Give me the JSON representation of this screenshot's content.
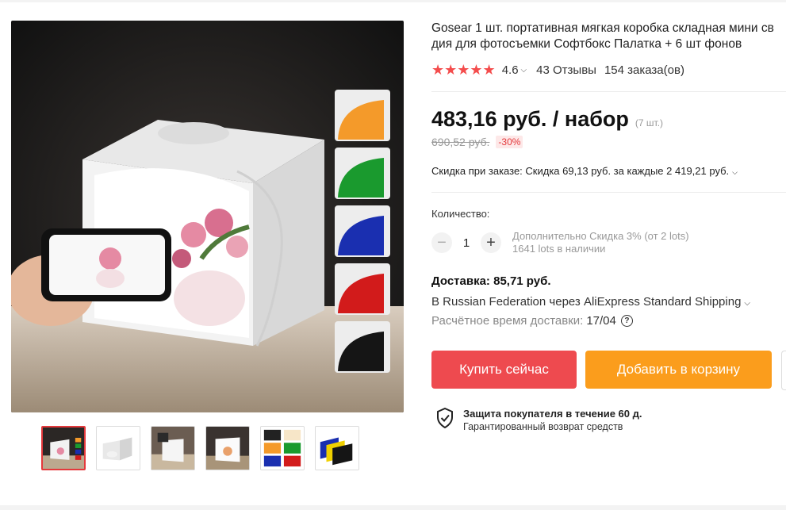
{
  "product": {
    "title_line1": "Gosear 1 шт. портативная мягкая коробка складная мини св",
    "title_line2": "дия для фотосъемки Софтбокс Палатка + 6 шт фонов"
  },
  "rating": {
    "stars": "★★★★★",
    "value": "4.6",
    "reviews": "43 Отзывы",
    "orders": "154 заказа(ов)"
  },
  "price": {
    "current": "483,16 руб. / набор",
    "unit_note": "(7 шт.)",
    "old": "690,52 руб.",
    "discount": "-30%"
  },
  "promo": {
    "text": "Скидка при заказе: Скидка 69,13 руб. за каждые 2 419,21 руб."
  },
  "quantity": {
    "label": "Количество:",
    "value": "1",
    "minus": "−",
    "plus": "+",
    "discount_note": "Дополнительно Скидка 3% (от 2 lots)",
    "stock": "1641 lots в наличии"
  },
  "delivery": {
    "price": "Доставка: 85,71 руб.",
    "method": "В Russian Federation через AliExpress Standard Shipping",
    "eta_label": "Расчётное время доставки:",
    "eta_value": "17/04"
  },
  "buttons": {
    "buy": "Купить сейчас",
    "cart": "Добавить в корзину"
  },
  "protection": {
    "title": "Защита покупателя в течение 60 д.",
    "subtitle": "Гарантированный возврат средств"
  },
  "colors": {
    "accent_red": "#ee4a4f",
    "accent_orange": "#fb9d1c",
    "star": "#f44c4c"
  }
}
